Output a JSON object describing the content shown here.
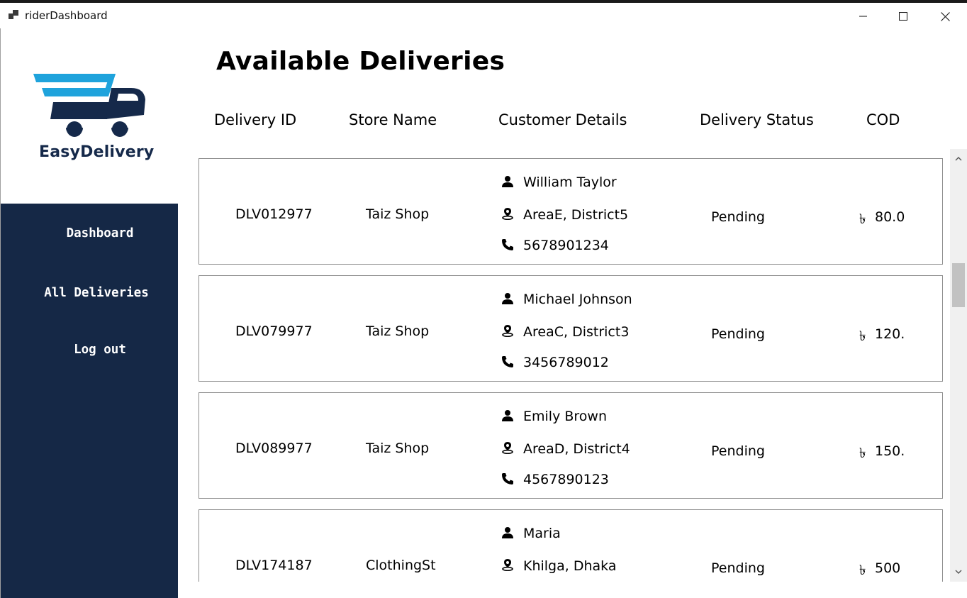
{
  "window": {
    "title": "riderDashboard"
  },
  "brand": {
    "name": "EasyDelivery",
    "primary_color": "#15294a",
    "accent_color": "#1fa3dc"
  },
  "sidebar": {
    "background": "#152846",
    "items": [
      {
        "label": "Dashboard"
      },
      {
        "label": "All Deliveries"
      },
      {
        "label": "Log out"
      }
    ]
  },
  "main": {
    "title": "Available Deliveries",
    "columns": [
      "Delivery ID",
      "Store Name",
      "Customer Details",
      "Delivery Status",
      "COD"
    ]
  },
  "deliveries": [
    {
      "id": "DLV012977",
      "store": "Taiz Shop",
      "customer": "William Taylor",
      "address": "AreaE, District5",
      "phone": "5678901234",
      "status": "Pending",
      "currency": "৳",
      "cod": "80.0"
    },
    {
      "id": "DLV079977",
      "store": "Taiz Shop",
      "customer": "Michael Johnson",
      "address": "AreaC, District3",
      "phone": "3456789012",
      "status": "Pending",
      "currency": "৳",
      "cod": "120."
    },
    {
      "id": "DLV089977",
      "store": "Taiz Shop",
      "customer": "Emily Brown",
      "address": "AreaD, District4",
      "phone": "4567890123",
      "status": "Pending",
      "currency": "৳",
      "cod": "150."
    },
    {
      "id": "DLV174187",
      "store": "ClothingSt",
      "customer": "Maria",
      "address": "Khilga, Dhaka",
      "phone": "",
      "status": "Pending",
      "currency": "৳",
      "cod": "500"
    }
  ]
}
